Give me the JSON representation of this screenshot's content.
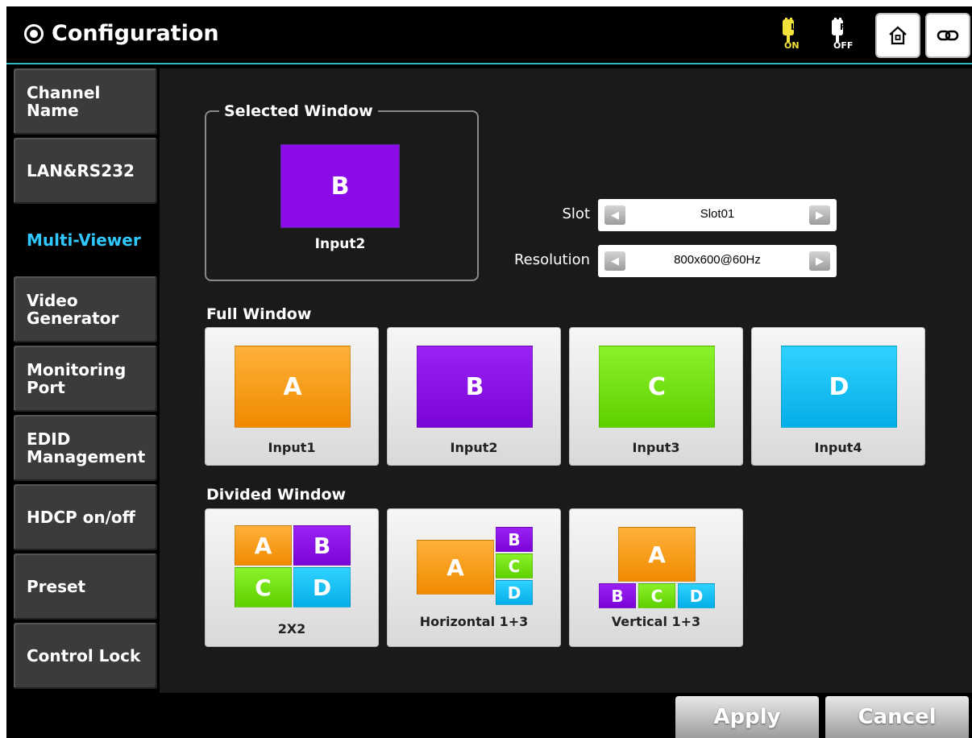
{
  "header": {
    "title": "Configuration",
    "plug_on": {
      "letter": "L",
      "state": "ON"
    },
    "plug_off": {
      "letter": "R",
      "state": "OFF"
    },
    "icons": [
      "gear-icon",
      "plug-on-icon",
      "plug-off-icon",
      "home-icon",
      "link-icon"
    ]
  },
  "sidebar": {
    "items": [
      {
        "label": "Channel\nName",
        "active": false
      },
      {
        "label": "LAN&RS232",
        "active": false
      },
      {
        "label": "Multi-Viewer",
        "active": true
      },
      {
        "label": "Video\nGenerator",
        "active": false
      },
      {
        "label": "Monitoring\nPort",
        "active": false
      },
      {
        "label": "EDID\nManagement",
        "active": false
      },
      {
        "label": "HDCP on/off",
        "active": false
      },
      {
        "label": "Preset",
        "active": false
      },
      {
        "label": "Control Lock",
        "active": false
      }
    ],
    "active_color": "#2fc8ff"
  },
  "selected_window": {
    "legend": "Selected Window",
    "tile_letter": "B",
    "tile_label": "Input2"
  },
  "slot": {
    "label": "Slot",
    "value": "Slot01"
  },
  "resolution": {
    "label": "Resolution",
    "value": "800x600@60Hz"
  },
  "full_window": {
    "heading": "Full Window",
    "cards": [
      {
        "letter": "A",
        "label": "Input1",
        "color": "#f59a10"
      },
      {
        "letter": "B",
        "label": "Input2",
        "color": "#8a0be8"
      },
      {
        "letter": "C",
        "label": "Input3",
        "color": "#72e010"
      },
      {
        "letter": "D",
        "label": "Input4",
        "color": "#10c0f5"
      }
    ]
  },
  "divided_window": {
    "heading": "Divided Window",
    "cards": [
      {
        "label": "2X2",
        "tiles": [
          "A",
          "B",
          "C",
          "D"
        ]
      },
      {
        "label": "Horizontal 1+3",
        "tiles": [
          "A",
          "B",
          "C",
          "D"
        ]
      },
      {
        "label": "Vertical 1+3",
        "tiles": [
          "A",
          "B",
          "C",
          "D"
        ]
      }
    ]
  },
  "footer": {
    "apply": "Apply",
    "cancel": "Cancel"
  },
  "colors": {
    "accent": "#2fb8c4",
    "a": "#f59a10",
    "b": "#8a0be8",
    "c": "#72e010",
    "d": "#10c0f5"
  }
}
